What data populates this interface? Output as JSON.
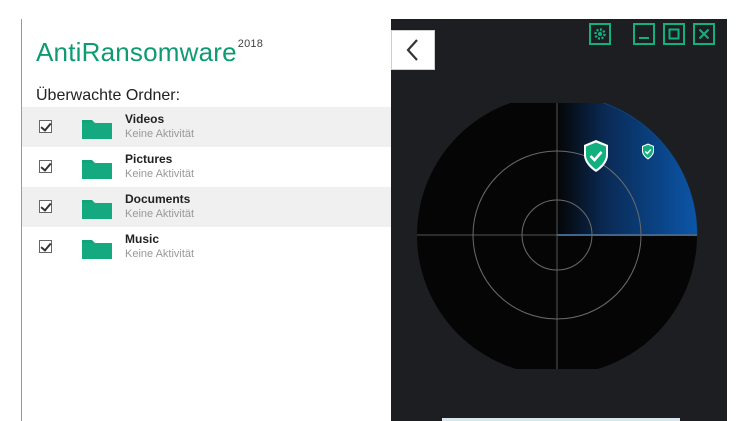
{
  "app": {
    "title": "AntiRansomware",
    "year": "2018"
  },
  "folders_heading": "Überwachte Ordner:",
  "folders": [
    {
      "name": "Videos",
      "status": "Keine Aktivität",
      "checked": true
    },
    {
      "name": "Pictures",
      "status": "Keine Aktivität",
      "checked": true
    },
    {
      "name": "Documents",
      "status": "Keine Aktivität",
      "checked": true
    },
    {
      "name": "Music",
      "status": "Keine Aktivität",
      "checked": true
    }
  ],
  "icons": {
    "back": "chevron-left-icon",
    "settings": "gear-icon",
    "minimize": "minimize-icon",
    "maximize": "maximize-icon",
    "close": "close-icon",
    "folder": "folder-icon",
    "shield": "shield-check-icon"
  },
  "colors": {
    "accent": "#0f9b72",
    "folder": "#12a47b",
    "dark_panel": "#1c1e21",
    "radar_bg": "#050505",
    "radar_sweep": "#0b4f9a"
  }
}
